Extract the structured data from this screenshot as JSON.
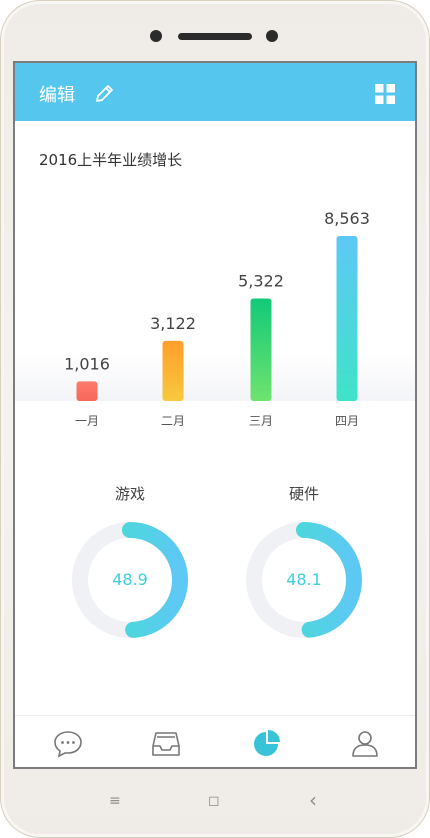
{
  "header": {
    "edit_label": "编辑"
  },
  "chart_data": {
    "type": "bar",
    "title": "2016上半年业绩增长",
    "categories": [
      "一月",
      "二月",
      "三月",
      "四月"
    ],
    "values": [
      1016,
      3122,
      5322,
      8563
    ],
    "value_labels": [
      "1,016",
      "3,122",
      "5,322",
      "8,563"
    ],
    "ylim": [
      0,
      8563
    ],
    "grid": false,
    "colors": [
      [
        "#f5685b",
        "#ff7b6b"
      ],
      [
        "#f7c93d",
        "#ff9e2c"
      ],
      [
        "#6fe36f",
        "#12c979"
      ],
      [
        "#3fe3c8",
        "#5ec8f5"
      ]
    ]
  },
  "donuts": [
    {
      "title": "游戏",
      "value": "48.9",
      "percent": 48.9
    },
    {
      "title": "硬件",
      "value": "48.1",
      "percent": 48.1
    }
  ],
  "colors": {
    "accent": "#55c7ee",
    "ring_start": "#3fe3c8",
    "ring_end": "#5ec8f5",
    "ring_track": "#f0f1f5"
  },
  "tabs": [
    {
      "name": "chat",
      "icon": "chat-bubble-icon",
      "active": false
    },
    {
      "name": "inbox",
      "icon": "inbox-tray-icon",
      "active": false
    },
    {
      "name": "chart",
      "icon": "pie-chart-icon",
      "active": true
    },
    {
      "name": "profile",
      "icon": "user-icon",
      "active": false
    }
  ],
  "system_nav": {
    "menu": "≡",
    "home": "◻",
    "back": "‹"
  }
}
